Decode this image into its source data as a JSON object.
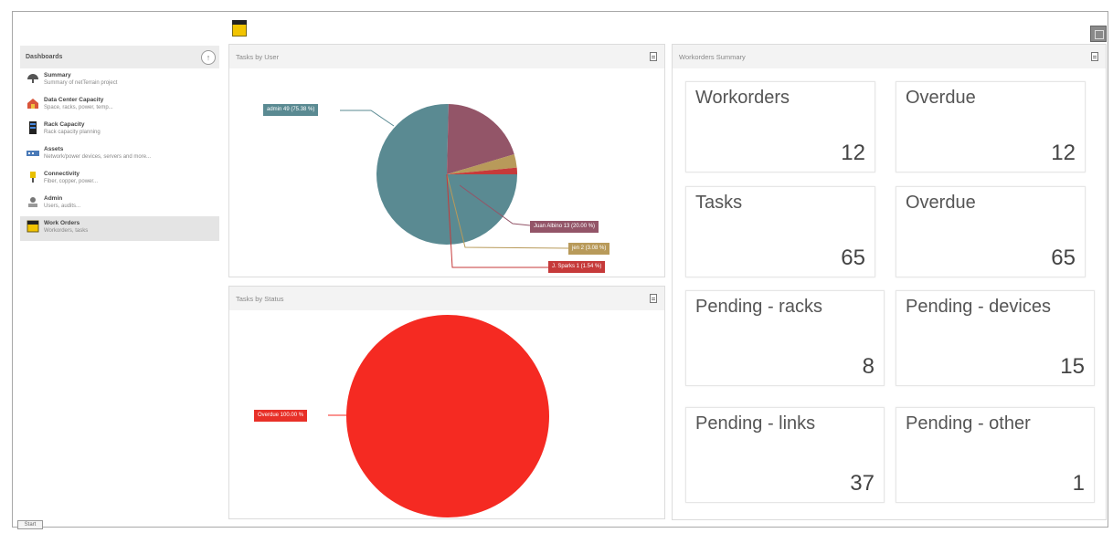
{
  "sidebar": {
    "title": "Dashboards",
    "items": [
      {
        "title": "Summary",
        "subtitle": "Summary of netTerrain project",
        "icon": "summary-icon"
      },
      {
        "title": "Data Center Capacity",
        "subtitle": "Space, racks, power, temp...",
        "icon": "datacenter-icon"
      },
      {
        "title": "Rack Capacity",
        "subtitle": "Rack capacity planning",
        "icon": "rack-icon"
      },
      {
        "title": "Assets",
        "subtitle": "Network/power devices, servers and more...",
        "icon": "assets-icon"
      },
      {
        "title": "Connectivity",
        "subtitle": "Fiber, copper, power...",
        "icon": "connectivity-icon"
      },
      {
        "title": "Admin",
        "subtitle": "Users, audits...",
        "icon": "admin-icon"
      },
      {
        "title": "Work Orders",
        "subtitle": "Workorders, tasks",
        "icon": "workorders-icon"
      }
    ]
  },
  "panels": {
    "tasks_by_user": {
      "title": "Tasks by User",
      "labels": [
        "admin 49 (75.38 %)",
        "Juan Albino 13 (20.00 %)",
        "jen 2 (3.08 %)",
        "J. Sparks 1 (1.54 %)"
      ]
    },
    "tasks_by_status": {
      "title": "Tasks by Status",
      "labels": [
        "Overdue 100.00 %"
      ]
    },
    "workorders_summary": {
      "title": "Workorders Summary",
      "tiles": [
        {
          "label": "Workorders",
          "value": "12"
        },
        {
          "label": "Overdue",
          "value": "12"
        },
        {
          "label": "Tasks",
          "value": "65"
        },
        {
          "label": "Overdue",
          "value": "65"
        },
        {
          "label": "Pending - racks",
          "value": "8"
        },
        {
          "label": "Pending - devices",
          "value": "15"
        },
        {
          "label": "Pending - links",
          "value": "37"
        },
        {
          "label": "Pending - other",
          "value": "1"
        }
      ]
    }
  },
  "charts": {
    "user_pie": {
      "values": [
        49,
        13,
        2,
        1
      ],
      "colors": [
        "#5a8a92",
        "#935568",
        "#b89a5a",
        "#c63a3a"
      ]
    },
    "status_pie": {
      "values": [
        100
      ],
      "colors": [
        "#f52a22"
      ]
    }
  },
  "taskbar": {
    "start_label": "Start"
  }
}
